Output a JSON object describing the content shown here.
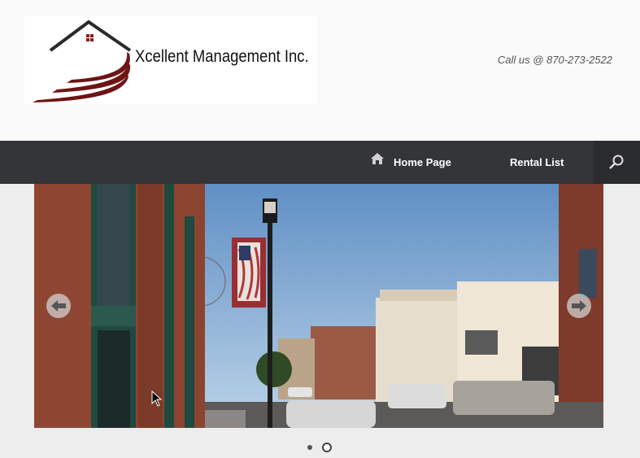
{
  "header": {
    "company_name": "Xcellent Management Inc.",
    "callus": "Call us @ 870-273-2522"
  },
  "nav": {
    "home_label": "Home Page",
    "rental_label": "Rental List"
  },
  "slider": {
    "slide_count": 2,
    "active_slide": 2
  },
  "colors": {
    "navbar": "#333538",
    "logo_red": "#6e1414",
    "logo_roof": "#2a2a2a"
  }
}
